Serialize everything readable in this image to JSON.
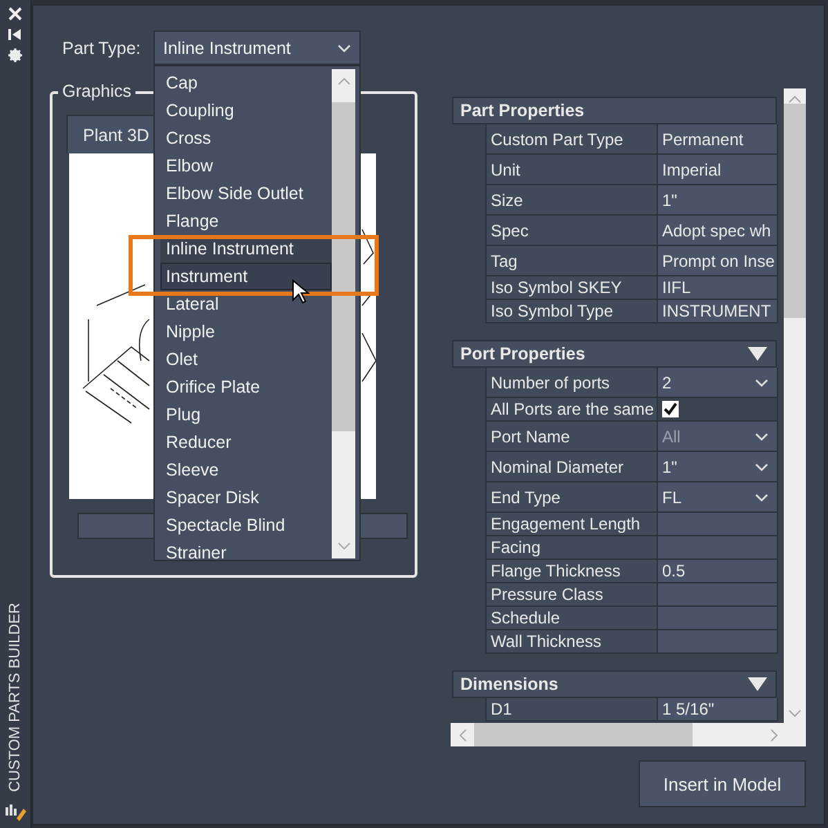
{
  "sidebar": {
    "title": "CUSTOM PARTS BUILDER"
  },
  "part_type": {
    "label": "Part Type:",
    "value": "Inline Instrument",
    "expanded": true,
    "options": [
      {
        "label": "Cap",
        "selected": false,
        "hovered": false
      },
      {
        "label": "Coupling",
        "selected": false,
        "hovered": false
      },
      {
        "label": "Cross",
        "selected": false,
        "hovered": false
      },
      {
        "label": "Elbow",
        "selected": false,
        "hovered": false
      },
      {
        "label": "Elbow Side Outlet",
        "selected": false,
        "hovered": false
      },
      {
        "label": "Flange",
        "selected": false,
        "hovered": false
      },
      {
        "label": "Inline Instrument",
        "selected": true,
        "hovered": false
      },
      {
        "label": "Instrument",
        "selected": false,
        "hovered": true
      },
      {
        "label": "Lateral",
        "selected": false,
        "hovered": false
      },
      {
        "label": "Nipple",
        "selected": false,
        "hovered": false
      },
      {
        "label": "Olet",
        "selected": false,
        "hovered": false
      },
      {
        "label": "Orifice Plate",
        "selected": false,
        "hovered": false
      },
      {
        "label": "Plug",
        "selected": false,
        "hovered": false
      },
      {
        "label": "Reducer",
        "selected": false,
        "hovered": false
      },
      {
        "label": "Sleeve",
        "selected": false,
        "hovered": false
      },
      {
        "label": "Spacer Disk",
        "selected": false,
        "hovered": false
      },
      {
        "label": "Spectacle Blind",
        "selected": false,
        "hovered": false
      },
      {
        "label": "Strainer",
        "selected": false,
        "hovered": false
      }
    ]
  },
  "graphics": {
    "title": "Graphics",
    "tab": "Plant 3D"
  },
  "sections": [
    {
      "title": "Part Properties",
      "collapsible": false,
      "rows": [
        {
          "kind": "field",
          "label": "Custom Part Type",
          "value": "Permanent"
        },
        {
          "kind": "field",
          "label": "Unit",
          "value": "Imperial"
        },
        {
          "kind": "field",
          "label": "Size",
          "value": "1\""
        },
        {
          "kind": "field",
          "label": "Spec",
          "value": "Adopt spec wh"
        },
        {
          "kind": "field",
          "label": "Tag",
          "value": "Prompt on Inse"
        },
        {
          "kind": "compact",
          "label": "Iso Symbol SKEY",
          "value": "IIFL"
        },
        {
          "kind": "compact",
          "label": "Iso Symbol Type",
          "value": "INSTRUMENT"
        }
      ]
    },
    {
      "title": "Port Properties",
      "collapsible": true,
      "rows": [
        {
          "kind": "combo",
          "label": "Number of ports",
          "value": "2",
          "disabled": false
        },
        {
          "kind": "check",
          "label": "All Ports are the same",
          "checked": true
        },
        {
          "kind": "combo",
          "label": "Port Name",
          "value": "All",
          "disabled": true
        },
        {
          "kind": "combo",
          "label": "Nominal Diameter",
          "value": "1\"",
          "disabled": false
        },
        {
          "kind": "combo",
          "label": "End Type",
          "value": "FL",
          "disabled": false
        },
        {
          "kind": "compact",
          "label": "Engagement Length"
        },
        {
          "kind": "compact",
          "label": "Facing"
        },
        {
          "kind": "compact",
          "label": "Flange Thickness",
          "value": "0.5"
        },
        {
          "kind": "compact",
          "label": "Pressure Class"
        },
        {
          "kind": "compact",
          "label": "Schedule"
        },
        {
          "kind": "compact",
          "label": "Wall Thickness"
        }
      ]
    },
    {
      "title": "Dimensions",
      "collapsible": true,
      "rows": [
        {
          "kind": "compact",
          "label": "D1",
          "value": "1 5/16\""
        }
      ]
    }
  ],
  "insert_button": "Insert in Model"
}
